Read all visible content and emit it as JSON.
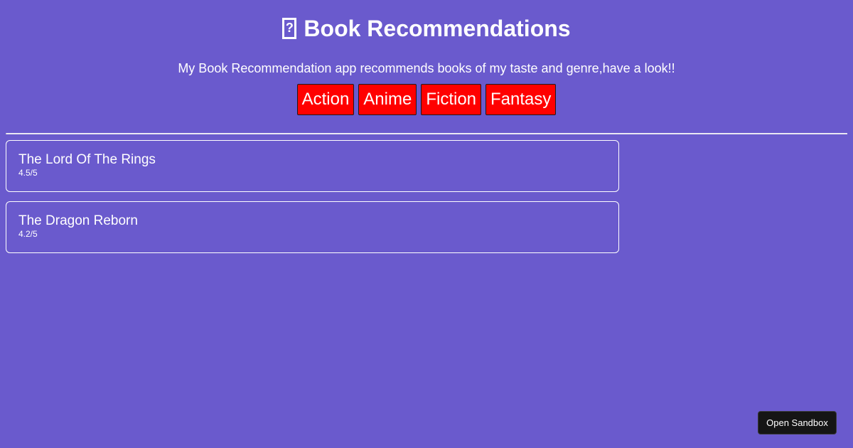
{
  "header": {
    "icon": "book-icon",
    "icon_glyph": "?",
    "title": "Book Recommendations",
    "subtitle": "My Book Recommendation app recommends books of my taste and genre,have a look!!"
  },
  "genres": [
    {
      "label": "Action"
    },
    {
      "label": "Anime"
    },
    {
      "label": "Fiction"
    },
    {
      "label": "Fantasy"
    }
  ],
  "books": [
    {
      "name": "The Lord Of The Rings",
      "rating": "4.5/5"
    },
    {
      "name": "The Dragon Reborn",
      "rating": "4.2/5"
    }
  ],
  "sandbox_button": {
    "label": "Open Sandbox"
  },
  "colors": {
    "background": "#6a5acd",
    "genre_button": "#ff0000",
    "sandbox_button": "#151515",
    "text": "#ffffff"
  }
}
